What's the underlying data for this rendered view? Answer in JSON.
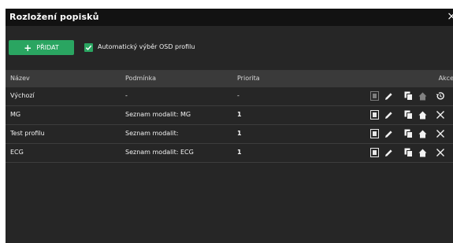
{
  "dialog": {
    "title": "Rozložení popisků",
    "close_label": "×"
  },
  "toolbar": {
    "add_label": "PŘIDAT",
    "add_icon": "+",
    "auto_checkbox_checked": true,
    "auto_checkbox_label": "Automatický výběr OSD profilu"
  },
  "table": {
    "headers": [
      "Název",
      "Podmínka",
      "Priorita",
      "Akce"
    ],
    "rows": [
      {
        "name": "Výchozí",
        "condition": "-",
        "priority": "-"
      },
      {
        "name": "MG",
        "condition": "Seznam modalit: MG",
        "priority": "1"
      },
      {
        "name": "Test profilu",
        "condition": "Seznam modalit:",
        "priority": "1"
      },
      {
        "name": "ECG",
        "condition": "Seznam modalit: ECG",
        "priority": "1"
      }
    ]
  },
  "colors": {
    "accent_green": "#2aa561",
    "background": "#262626",
    "titlebar": "#121212",
    "header_row": "#3a3a3a"
  }
}
